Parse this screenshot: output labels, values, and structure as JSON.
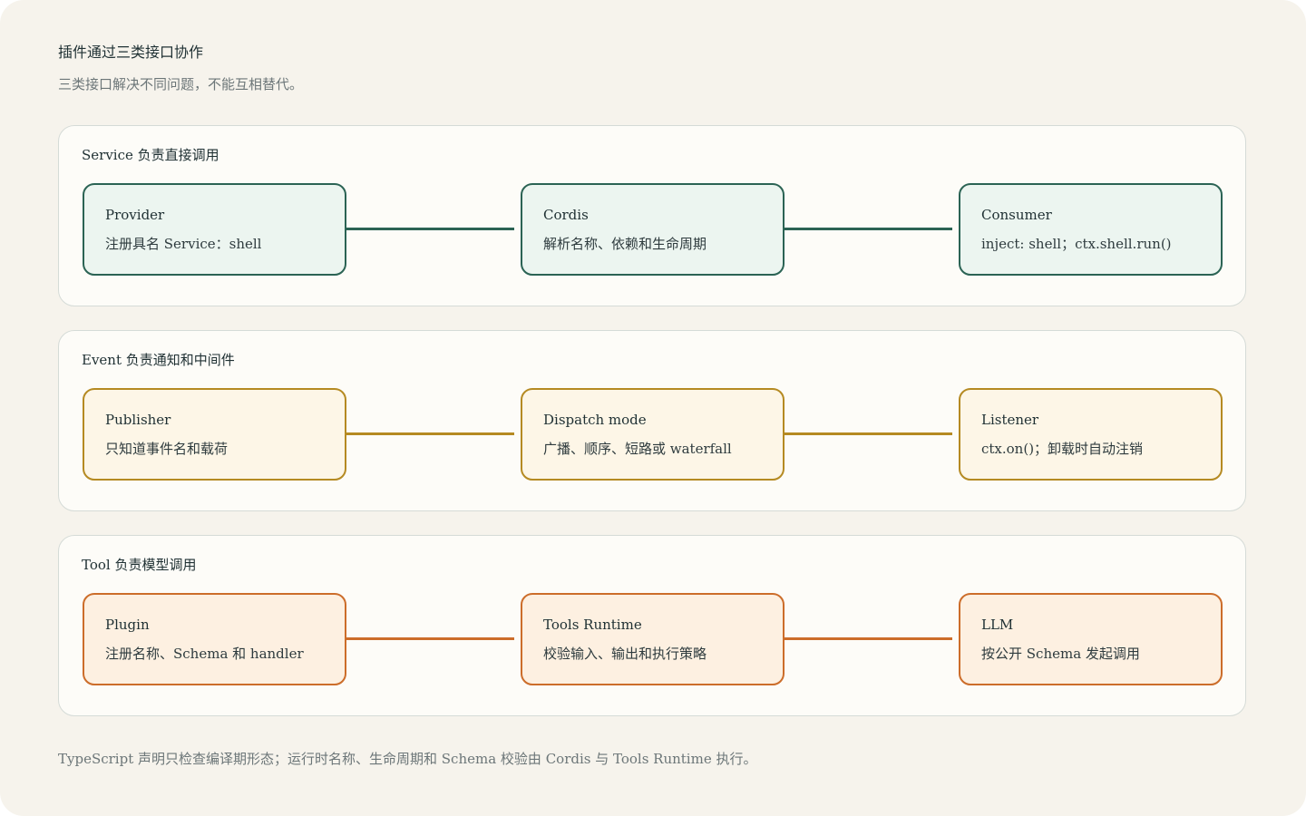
{
  "header": {
    "title": "插件通过三类接口协作",
    "subtitle": "三类接口解决不同问题，不能互相替代。"
  },
  "panels": [
    {
      "title": "Service 负责直接调用",
      "colors": {
        "border": "#2b6354",
        "fill": "#ecf5f0",
        "line": "#2b6354"
      },
      "nodes": [
        {
          "title": "Provider",
          "desc": "注册具名 Service：shell"
        },
        {
          "title": "Cordis",
          "desc": "解析名称、依赖和生命周期"
        },
        {
          "title": "Consumer",
          "desc": "inject: shell；ctx.shell.run()"
        }
      ]
    },
    {
      "title": "Event 负责通知和中间件",
      "colors": {
        "border": "#b58a22",
        "fill": "#fdf6e7",
        "line": "#b58a22"
      },
      "nodes": [
        {
          "title": "Publisher",
          "desc": "只知道事件名和载荷"
        },
        {
          "title": "Dispatch mode",
          "desc": "广播、顺序、短路或 waterfall"
        },
        {
          "title": "Listener",
          "desc": "ctx.on()；卸载时自动注销"
        }
      ]
    },
    {
      "title": "Tool 负责模型调用",
      "colors": {
        "border": "#cc6d2a",
        "fill": "#fdf0e1",
        "line": "#cc6d2a"
      },
      "nodes": [
        {
          "title": "Plugin",
          "desc": "注册名称、Schema 和 handler"
        },
        {
          "title": "Tools Runtime",
          "desc": "校验输入、输出和执行策略"
        },
        {
          "title": "LLM",
          "desc": "按公开 Schema 发起调用"
        }
      ]
    }
  ],
  "footnote": "TypeScript 声明只检查编译期形态；运行时名称、生命周期和 Schema 校验由 Cordis 与 Tools Runtime 执行。"
}
